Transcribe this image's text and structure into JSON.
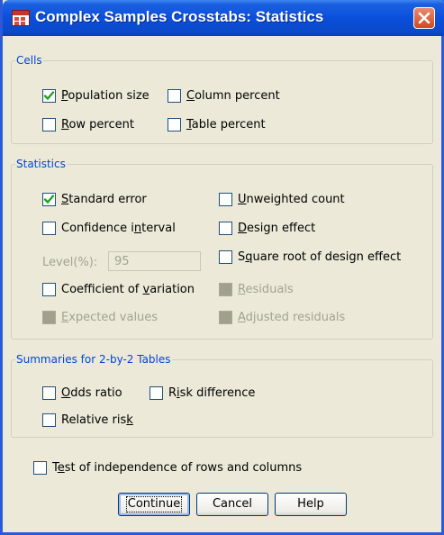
{
  "window": {
    "title": "Complex Samples Crosstabs: Statistics"
  },
  "cells": {
    "legend": "Cells",
    "population_size": {
      "pre": "",
      "u": "P",
      "post": "opulation size",
      "checked": true
    },
    "column_percent": {
      "pre": "",
      "u": "C",
      "post": "olumn percent",
      "checked": false
    },
    "row_percent": {
      "pre": "",
      "u": "R",
      "post": "ow percent",
      "checked": false
    },
    "table_percent": {
      "pre": "",
      "u": "T",
      "post": "able percent",
      "checked": false
    }
  },
  "statistics": {
    "legend": "Statistics",
    "standard_error": {
      "pre": "",
      "u": "S",
      "post": "tandard error",
      "checked": true
    },
    "confidence_interval": {
      "pre": "Confidence i",
      "u": "n",
      "post": "terval",
      "checked": false
    },
    "level_label": "Level(%):",
    "level_value": "95",
    "coefficient_of_variation": {
      "pre": "Coefficient of ",
      "u": "v",
      "post": "ariation",
      "checked": false
    },
    "expected_values": {
      "pre": "",
      "u": "E",
      "post": "xpected values",
      "checked": false
    },
    "unweighted_count": {
      "pre": "",
      "u": "U",
      "post": "nweighted count",
      "checked": false
    },
    "design_effect": {
      "pre": "",
      "u": "D",
      "post": "esign effect",
      "checked": false
    },
    "sqrt_design_effect": {
      "pre": "S",
      "u": "q",
      "post": "uare root of design effect",
      "checked": false
    },
    "residuals": {
      "pre": "",
      "u": "R",
      "post": "esiduals",
      "checked": false
    },
    "adjusted_residuals": {
      "pre": "",
      "u": "A",
      "post": "djusted residuals",
      "checked": false
    }
  },
  "summaries": {
    "legend": "Summaries for 2-by-2 Tables",
    "odds_ratio": {
      "pre": "",
      "u": "O",
      "post": "dds ratio",
      "checked": false
    },
    "risk_difference": {
      "pre": "R",
      "u": "i",
      "post": "sk difference",
      "checked": false
    },
    "relative_risk": {
      "pre": "Relative ris",
      "u": "k",
      "post": "",
      "checked": false
    }
  },
  "independence": {
    "pre": "T",
    "u": "e",
    "post": "st of independence of rows and columns",
    "checked": false
  },
  "buttons": {
    "continue": "Continue",
    "cancel": "Cancel",
    "help": "Help"
  }
}
